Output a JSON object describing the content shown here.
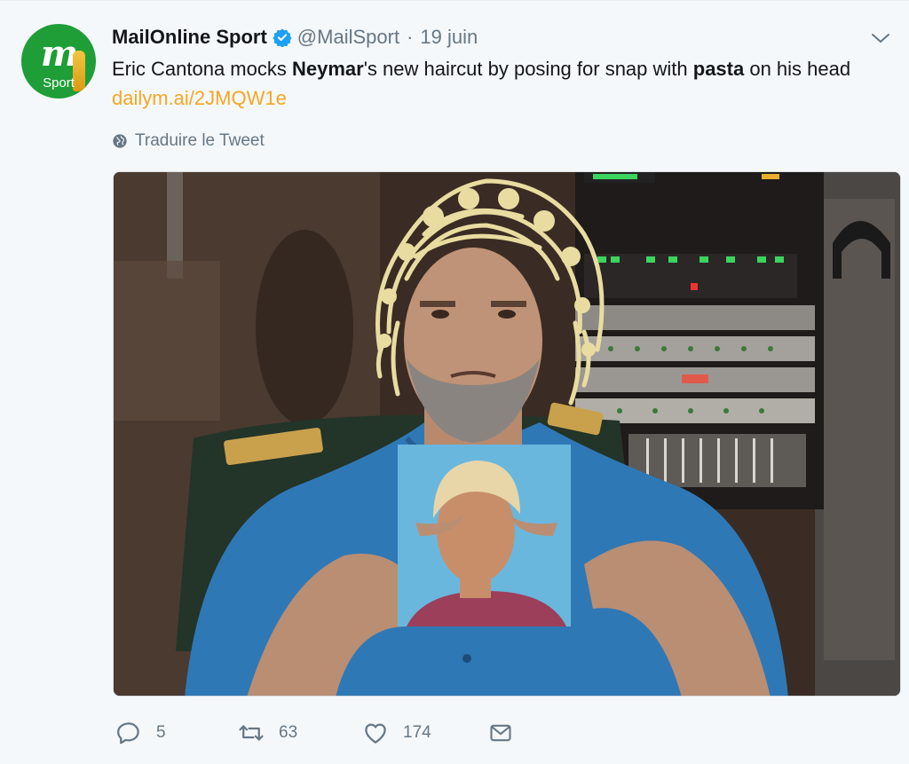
{
  "tweet": {
    "display_name": "MailOnline Sport",
    "handle": "@MailSport",
    "separator": "·",
    "date": "19 juin",
    "avatar_text": "m",
    "avatar_sub": "Sport",
    "text": {
      "part1": "Eric Cantona mocks ",
      "bold1": "Neymar",
      "part2": "'s new haircut by posing for snap with ",
      "bold2": "pasta",
      "part3": " on his head ",
      "link": "dailym.ai/2JMQW1e"
    },
    "translate_label": "Traduire le Tweet",
    "actions": {
      "replies": "5",
      "retweets": "63",
      "likes": "174"
    }
  },
  "colors": {
    "accent_link": "#f5a623",
    "verified": "#1da1f2",
    "muted": "#657786",
    "avatar_bg": "#1f9e37"
  },
  "icons": {
    "verified": "verified-badge-icon",
    "caret": "chevron-down-icon",
    "translate": "globe-icon",
    "reply": "reply-icon",
    "retweet": "retweet-icon",
    "like": "heart-icon",
    "dm": "envelope-icon"
  }
}
